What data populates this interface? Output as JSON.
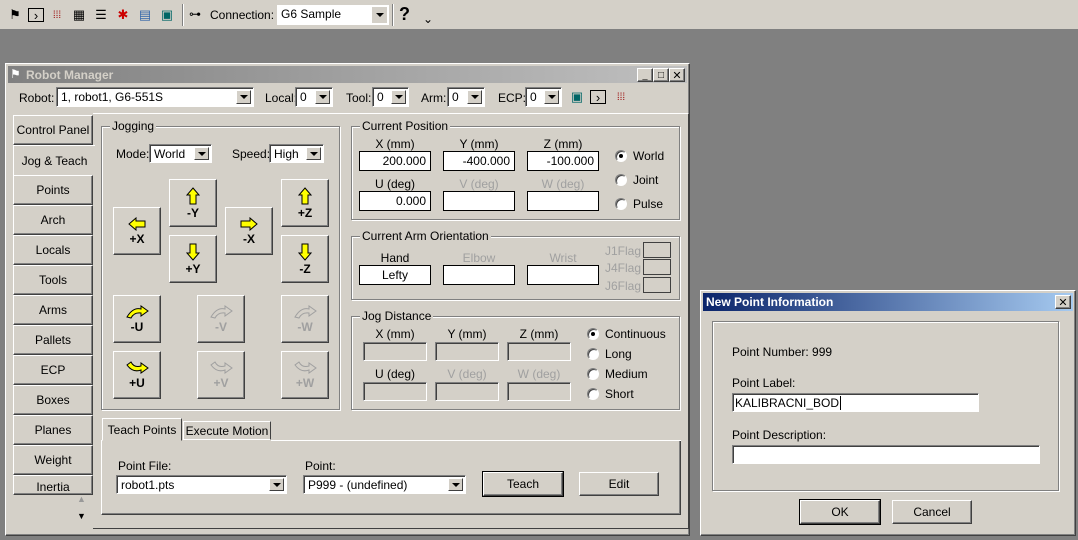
{
  "toolbar": {
    "icons": [
      "robot-manager-icon",
      "command-window-icon",
      "io-monitor-icon",
      "task-manager-icon",
      "list-icon",
      "simulator-icon",
      "form-icon",
      "camera-icon"
    ],
    "connection_label": "Connection:",
    "connection_value": "G6 Sample",
    "help_label": "?"
  },
  "window": {
    "title": "Robot Manager",
    "robot_label": "Robot:",
    "robot_value": "1, robot1, G6-551S",
    "local_label": "Local:",
    "local_value": "0",
    "tool_label": "Tool:",
    "tool_value": "0",
    "arm_label": "Arm:",
    "arm_value": "0",
    "ecp_label": "ECP:",
    "ecp_value": "0"
  },
  "side_tabs": [
    "Control Panel",
    "Jog & Teach",
    "Points",
    "Arch",
    "Locals",
    "Tools",
    "Arms",
    "Pallets",
    "ECP",
    "Boxes",
    "Planes",
    "Weight",
    "Inertia"
  ],
  "jogging": {
    "title": "Jogging",
    "mode_label": "Mode:",
    "mode_value": "World",
    "speed_label": "Speed:",
    "speed_value": "High",
    "buttons": {
      "px": "+X",
      "my": "-Y",
      "py": "+Y",
      "mx": "-X",
      "pz": "+Z",
      "mz": "-Z",
      "mu": "-U",
      "mv": "-V",
      "mw": "-W",
      "pu": "+U",
      "pv": "+V",
      "pw": "+W"
    }
  },
  "current_position": {
    "title": "Current Position",
    "x_label": "X (mm)",
    "y_label": "Y (mm)",
    "z_label": "Z (mm)",
    "x": "200.000",
    "y": "-400.000",
    "z": "-100.000",
    "u_label": "U (deg)",
    "v_label": "V (deg)",
    "w_label": "W (deg)",
    "u": "0.000",
    "v": "",
    "w": "",
    "modes": [
      "World",
      "Joint",
      "Pulse"
    ],
    "selected": "World"
  },
  "arm_orientation": {
    "title": "Current Arm Orientation",
    "hand_label": "Hand",
    "hand": "Lefty",
    "elbow_label": "Elbow",
    "wrist_label": "Wrist",
    "j1": "J1Flag",
    "j4": "J4Flag",
    "j6": "J6Flag"
  },
  "jog_distance": {
    "title": "Jog Distance",
    "x_label": "X (mm)",
    "y_label": "Y (mm)",
    "z_label": "Z (mm)",
    "u_label": "U (deg)",
    "v_label": "V (deg)",
    "w_label": "W (deg)",
    "modes": [
      "Continuous",
      "Long",
      "Medium",
      "Short"
    ],
    "selected": "Continuous"
  },
  "bottom_tabs": [
    "Teach Points",
    "Execute Motion"
  ],
  "teach": {
    "point_file_label": "Point File:",
    "point_file": "robot1.pts",
    "point_label": "Point:",
    "point": "P999 - (undefined)",
    "teach_button": "Teach",
    "edit_button": "Edit"
  },
  "dialog": {
    "title": "New Point Information",
    "point_number": "Point Number: 999",
    "label_label": "Point Label:",
    "label_value": "KALIBRACNI_BOD",
    "desc_label": "Point Description:",
    "desc_value": "",
    "ok": "OK",
    "cancel": "Cancel"
  },
  "colors": {
    "face": "#d4d0c8",
    "desktop": "#808080",
    "active_title": "#0a246a",
    "inactive_title": "#808080",
    "arrow": "#ffff00"
  }
}
